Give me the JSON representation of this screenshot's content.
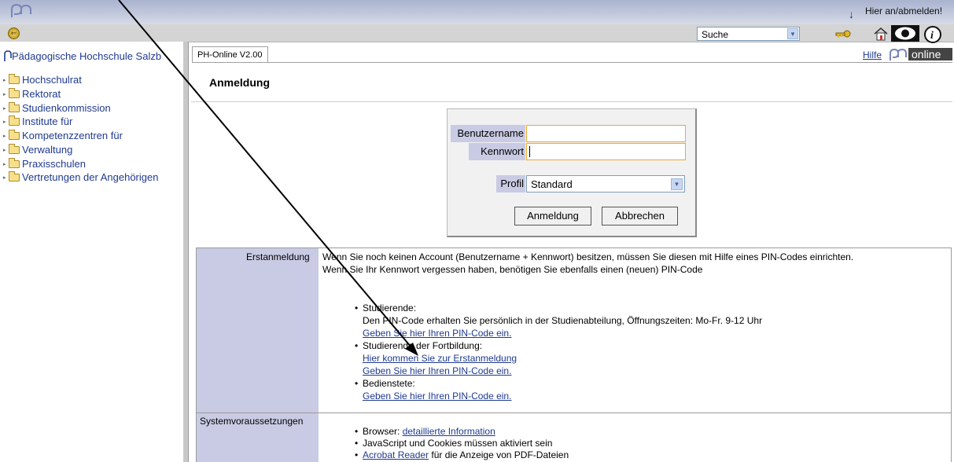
{
  "topbar": {
    "login_link": "Hier an/abmelden!",
    "search_select": {
      "selected": "Suche"
    },
    "icons": [
      "key-icon",
      "home-icon",
      "eye-icon",
      "info-icon"
    ]
  },
  "sidebar": {
    "title": "Pädagogische Hochschule Salzb",
    "items": [
      {
        "label": "Hochschulrat"
      },
      {
        "label": "Rektorat"
      },
      {
        "label": "Studienkommission"
      },
      {
        "label": "Institute für"
      },
      {
        "label": "Kompetenzzentren für"
      },
      {
        "label": "Verwaltung"
      },
      {
        "label": "Praxisschulen"
      },
      {
        "label": "Vertretungen der Angehörigen"
      }
    ]
  },
  "header": {
    "tab_label": "PH-Online V2.00",
    "help_link": "Hilfe",
    "logo_text": "online",
    "page_title": "Anmeldung"
  },
  "login": {
    "username_label": "Benutzername",
    "username_value": "",
    "password_label": "Kennwort",
    "password_value": "",
    "profile_label": "Profil",
    "profile_value": "Standard",
    "submit_label": "Anmeldung",
    "cancel_label": "Abbrechen"
  },
  "info": {
    "erstanmeldung_label": "Erstanmeldung",
    "intro_line1": "Wenn Sie noch keinen Account (Benutzername + Kennwort) besitzen, müssen Sie diesen mit Hilfe eines PIN-Codes einrichten.",
    "intro_line2": "Wenn Sie Ihr Kennwort vergessen haben, benötigen Sie ebenfalls einen (neuen) PIN-Code",
    "groups": [
      {
        "title": "Studierende:",
        "text": "Den PIN-Code erhalten Sie persönlich in der Studienabteilung, Öffnungszeiten: Mo-Fr. 9-12 Uhr",
        "links": [
          "Geben Sie hier Ihren PIN-Code ein."
        ]
      },
      {
        "title": "Studierende der Fortbildung:",
        "links": [
          "Hier kommen Sie zur Erstanmeldung",
          "Geben Sie hier Ihren PIN-Code ein."
        ]
      },
      {
        "title": "Bedienstete:",
        "links": [
          "Geben Sie hier Ihren PIN-Code ein."
        ]
      }
    ],
    "system_label": "Systemvoraussetzungen",
    "system": {
      "browser_prefix": "Browser: ",
      "browser_link": "detaillierte Information",
      "js_text": "JavaScript und Cookies müssen aktiviert sein",
      "acrobat_link": "Acrobat Reader",
      "acrobat_suffix": " für die Anzeige von PDF-Dateien"
    }
  }
}
